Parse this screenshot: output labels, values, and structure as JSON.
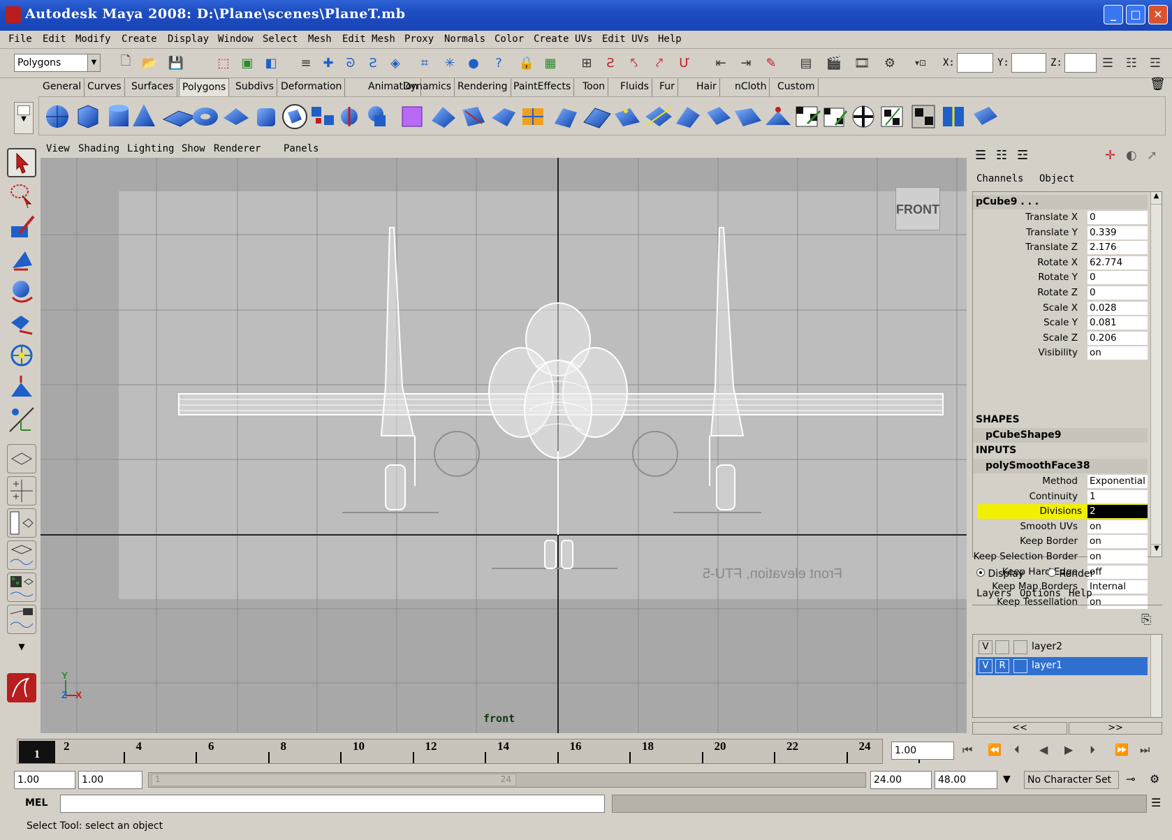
{
  "window": {
    "title": "Autodesk Maya 2008: D:\\Plane\\scenes\\PlaneT.mb"
  },
  "menubar": [
    "File",
    "Edit",
    "Modify",
    "Create",
    "Display",
    "Window",
    "Select",
    "Mesh",
    "Edit Mesh",
    "Proxy",
    "Normals",
    "Color",
    "Create UVs",
    "Edit UVs",
    "Help"
  ],
  "statusline": {
    "menu_set": "Polygons",
    "x_label": "X:",
    "y_label": "Y:",
    "z_label": "Z:",
    "x_value": "",
    "y_value": "",
    "z_value": ""
  },
  "shelf": {
    "tabs": [
      "General",
      "Curves",
      "Surfaces",
      "Polygons",
      "Subdivs",
      "Deformation",
      "Animation",
      "Dynamics",
      "Rendering",
      "PaintEffects",
      "Toon",
      "Fluids",
      "Fur",
      "Hair",
      "nCloth",
      "Custom"
    ],
    "active_tab": "Polygons"
  },
  "viewport": {
    "menus": [
      "View",
      "Shading",
      "Lighting",
      "Show",
      "Renderer",
      "Panels"
    ],
    "camera_label": "front",
    "viewcube_label": "FRONT",
    "image_plane_text": "Front elevation, FTU-5",
    "axis_y": "Y",
    "axis_z": "Z",
    "axis_x": "X"
  },
  "channel_box": {
    "tabs": [
      "Channels",
      "Object"
    ],
    "node": "pCube9 . . .",
    "channels": [
      {
        "name": "Translate X",
        "value": "0"
      },
      {
        "name": "Translate Y",
        "value": "0.339"
      },
      {
        "name": "Translate Z",
        "value": "2.176"
      },
      {
        "name": "Rotate X",
        "value": "62.774"
      },
      {
        "name": "Rotate Y",
        "value": "0"
      },
      {
        "name": "Rotate Z",
        "value": "0"
      },
      {
        "name": "Scale X",
        "value": "0.028"
      },
      {
        "name": "Scale Y",
        "value": "0.081"
      },
      {
        "name": "Scale Z",
        "value": "0.206"
      },
      {
        "name": "Visibility",
        "value": "on"
      }
    ],
    "shapes_header": "SHAPES",
    "shape_node": "pCubeShape9",
    "inputs_header": "INPUTS",
    "input_node": "polySmoothFace38",
    "inputs": [
      {
        "name": "Method",
        "value": "Exponential"
      },
      {
        "name": "Continuity",
        "value": "1"
      },
      {
        "name": "Divisions",
        "value": "2"
      },
      {
        "name": "Smooth UVs",
        "value": "on"
      },
      {
        "name": "Keep Border",
        "value": "on"
      },
      {
        "name": "Keep Selection Border",
        "value": "on"
      },
      {
        "name": "Keep Hard Edge",
        "value": "off"
      },
      {
        "name": "Keep Map Borders",
        "value": "Internal"
      },
      {
        "name": "Keep Tessellation",
        "value": "on"
      }
    ],
    "highlight_color": "#f0f000"
  },
  "layer_editor": {
    "mode_display": "Display",
    "mode_render": "Render",
    "menus": [
      "Layers",
      "Options",
      "Help"
    ],
    "layers": [
      {
        "v": "V",
        "r": "",
        "name": "layer2",
        "selected": false
      },
      {
        "v": "V",
        "r": "R",
        "name": "layer1",
        "selected": true
      }
    ],
    "scroll_left": "<<",
    "scroll_right": ">>"
  },
  "time_slider": {
    "current_frame": "1",
    "labels": [
      "2",
      "4",
      "6",
      "8",
      "10",
      "12",
      "14",
      "16",
      "18",
      "20",
      "22",
      "24"
    ],
    "current_time_field": "1.00"
  },
  "range_slider": {
    "start_time": "1.00",
    "playback_start": "1.00",
    "range_start_label": "1",
    "range_end_label": "24",
    "playback_end": "24.00",
    "end_time": "48.00",
    "character_set": "No Character Set"
  },
  "command_line": {
    "label": "MEL",
    "value": ""
  },
  "help_line": {
    "text": "Select Tool: select an object"
  },
  "colors": {
    "title_blue": "#1d4dc0",
    "ui_gray": "#d4d0c8",
    "selection_blue": "#2f6fd0",
    "viewport_gray": "#a8a8a8"
  }
}
